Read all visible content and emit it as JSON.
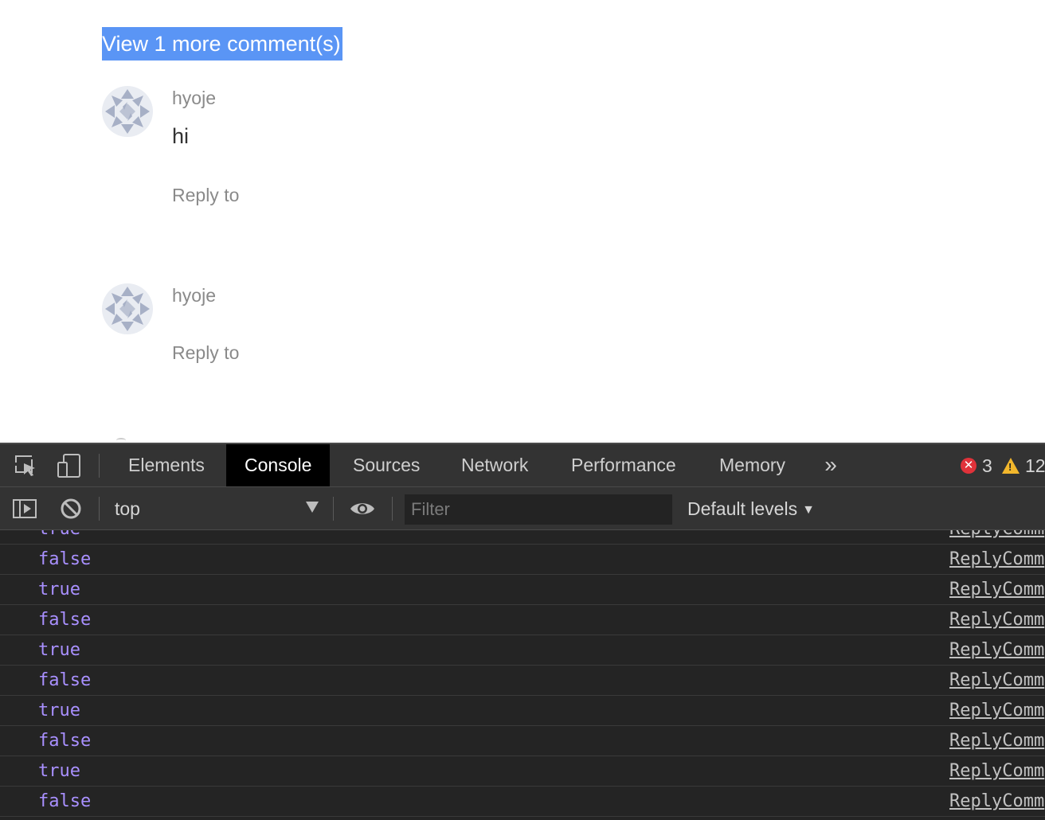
{
  "page": {
    "view_more_label": "View 1 more comment(s)",
    "comments": [
      {
        "author": "hyoje",
        "text": "hi",
        "reply_label": "Reply to"
      },
      {
        "author": "hyoje",
        "text": "",
        "reply_label": "Reply to"
      }
    ]
  },
  "devtools": {
    "tabs": [
      "Elements",
      "Console",
      "Sources",
      "Network",
      "Performance",
      "Memory"
    ],
    "active_tab": "Console",
    "more_tabs_glyph": "»",
    "error_count": "3",
    "warning_count": "12",
    "context": "top",
    "filter_placeholder": "Filter",
    "levels_label": "Default levels",
    "console_rows": [
      {
        "value": "true",
        "source": "ReplyComm"
      },
      {
        "value": "false",
        "source": "ReplyComm"
      },
      {
        "value": "true",
        "source": "ReplyComm"
      },
      {
        "value": "false",
        "source": "ReplyComm"
      },
      {
        "value": "true",
        "source": "ReplyComm"
      },
      {
        "value": "false",
        "source": "ReplyComm"
      },
      {
        "value": "true",
        "source": "ReplyComm"
      },
      {
        "value": "false",
        "source": "ReplyComm"
      },
      {
        "value": "true",
        "source": "ReplyComm"
      },
      {
        "value": "false",
        "source": "ReplyComm"
      }
    ]
  },
  "colors": {
    "selection_highlight": "#5a95f5",
    "console_value": "#a990ff",
    "devtools_bg": "#242424",
    "error": "#e0323a",
    "warning": "#f2b72c"
  }
}
